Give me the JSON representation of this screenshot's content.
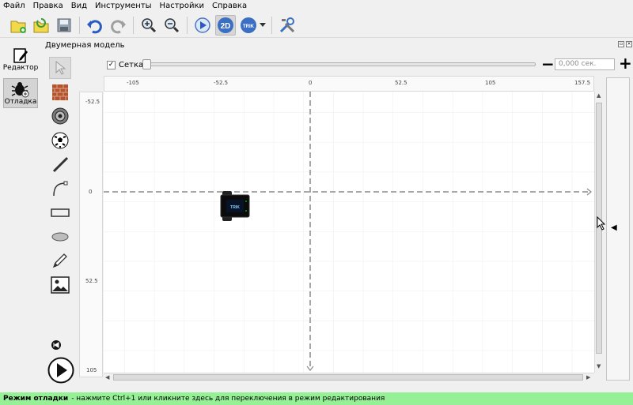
{
  "menu": [
    "Файл",
    "Правка",
    "Вид",
    "Инструменты",
    "Настройки",
    "Справка"
  ],
  "toolbar": {
    "icons": [
      "new-project-icon",
      "open-icon",
      "save-icon",
      "undo-icon",
      "redo-icon",
      "zoom-in-icon",
      "zoom-out-icon",
      "run-icon",
      "mode-2d-icon",
      "trik-robot-icon",
      "dropdown-arrow-icon",
      "tools-icon"
    ],
    "mode_2d_label": "2D",
    "trik_label": "TRIK"
  },
  "left_dock": {
    "editor_label": "Редактор",
    "debug_label": "Отладка"
  },
  "panel": {
    "title": "Двумерная модель"
  },
  "palette": [
    "cursor-icon",
    "wall-icon",
    "ball-skittle-icon",
    "ball-icon",
    "line-icon",
    "curve-icon",
    "rectangle-icon",
    "ellipse-icon",
    "pencil-icon",
    "image-icon"
  ],
  "grid_controls": {
    "grid_label": "Сетка",
    "grid_checked": true,
    "time_placeholder": "0,000 сек.",
    "slider_value": 0
  },
  "ruler": {
    "top_ticks": [
      "-105",
      "-52.5",
      "0",
      "52.5",
      "105",
      "157.5"
    ],
    "left_ticks": [
      "-52.5",
      "0",
      "52.5",
      "105"
    ]
  },
  "robot": {
    "label": "TRIK"
  },
  "status": {
    "mode": "Режим отладки",
    "hint": "- нажмите Ctrl+1 или кликните здесь для переключения в режим редактирования"
  },
  "colors": {
    "status_bg": "#96f096",
    "grid_line": "#e4e4e4",
    "axis_line": "#888888"
  }
}
